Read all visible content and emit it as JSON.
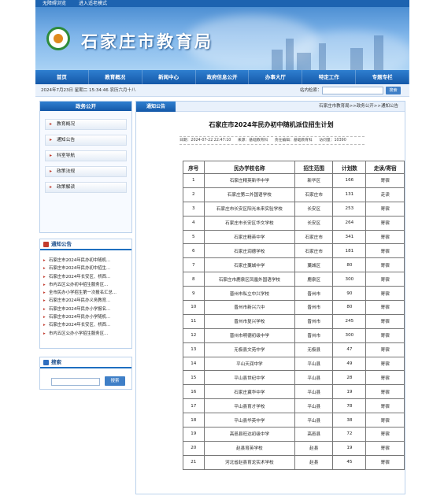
{
  "topbar": {
    "links": [
      "无障碍浏览",
      "进入适老模式"
    ]
  },
  "header": {
    "site_title": "石家庄市教育局"
  },
  "nav": {
    "items": [
      "首页",
      "教育概况",
      "新闻中心",
      "政府信息公开",
      "办事大厅",
      "特定工作",
      "专题专栏"
    ]
  },
  "infobar": {
    "date": "2024年7月23日 星期二 15:34:46 农历六月十八",
    "search_label": "站内检索：",
    "search_button": "搜索"
  },
  "left": {
    "public_title": "政务公开",
    "menu": [
      "教育概况",
      "通知公告",
      "科室导航",
      "政策法规",
      "政策解读"
    ],
    "notice_title": "通知公告",
    "notices": [
      "石家庄市2024年民办初中随机...",
      "石家庄市2024年民办初中招生...",
      "石家庄市2024年长安区、桥西...",
      "市内五区公办初中招生服务区...",
      "全市民办小学招生第一次报名汇总...",
      "石家庄市2024年民办义务教育...",
      "石家庄市2024年民办小学报名...",
      "石家庄市2024年民办小学随机...",
      "石家庄市2024年长安区、桥西...",
      "市内五区公办小学招生服务区..."
    ],
    "search_title": "搜索",
    "search_button": "搜索"
  },
  "main": {
    "tab": "通知公告",
    "breadcrumb": "石家庄市教育局>>政务公开>>通知公告",
    "title": "石家庄市2024年民办初中随机派位招生计划",
    "meta": {
      "date": "日期：2024-07-22 22:47:10",
      "source": "来源：基础教育科",
      "editor": "责任编辑：基础教育科",
      "hits": "访问量：10390"
    },
    "table": {
      "headers": [
        "序号",
        "民办学校名称",
        "招生范围",
        "计划数",
        "走读/寄宿"
      ],
      "rows": [
        [
          "1",
          "石家庄精英新华中学",
          "新华区",
          "166",
          "寄宿"
        ],
        [
          "2",
          "石家庄第二外国语学校",
          "石家庄市",
          "131",
          "走读"
        ],
        [
          "3",
          "石家庄市长安区阳光未来实验学校",
          "长安区",
          "253",
          "寄宿"
        ],
        [
          "4",
          "石家庄市长安区华文学校",
          "长安区",
          "264",
          "寄宿"
        ],
        [
          "5",
          "石家庄精英中学",
          "石家庄市",
          "341",
          "寄宿"
        ],
        [
          "6",
          "石家庄润德学校",
          "石家庄市",
          "181",
          "寄宿"
        ],
        [
          "7",
          "石家庄藁城中学",
          "藁城区",
          "80",
          "寄宿"
        ],
        [
          "8",
          "石家庄市鹿泉区凤凰外国语学校",
          "鹿泉区",
          "300",
          "寄宿"
        ],
        [
          "9",
          "晋州市私立中兴学校",
          "晋州市",
          "90",
          "寄宿"
        ],
        [
          "10",
          "晋州市新兴六中",
          "晋州市",
          "80",
          "寄宿"
        ],
        [
          "11",
          "晋州市复兴学校",
          "晋州市",
          "245",
          "寄宿"
        ],
        [
          "12",
          "晋州市明德初级中学",
          "晋州市",
          "300",
          "寄宿"
        ],
        [
          "13",
          "无极县文苑中学",
          "无极县",
          "47",
          "寄宿"
        ],
        [
          "14",
          "平山天润中学",
          "平山县",
          "49",
          "寄宿"
        ],
        [
          "15",
          "平山县世纪中学",
          "平山县",
          "28",
          "寄宿"
        ],
        [
          "16",
          "石家庄冀华中学",
          "平山县",
          "19",
          "寄宿"
        ],
        [
          "17",
          "平山县育才学校",
          "平山县",
          "78",
          "寄宿"
        ],
        [
          "18",
          "平山县华英中学",
          "平山县",
          "38",
          "寄宿"
        ],
        [
          "19",
          "高邑县旺达初级中学",
          "高邑县",
          "72",
          "寄宿"
        ],
        [
          "20",
          "赵县育英学校",
          "赵县",
          "19",
          "寄宿"
        ],
        [
          "21",
          "河北省赵县育龙实术学校",
          "赵县",
          "45",
          "寄宿"
        ]
      ]
    }
  }
}
